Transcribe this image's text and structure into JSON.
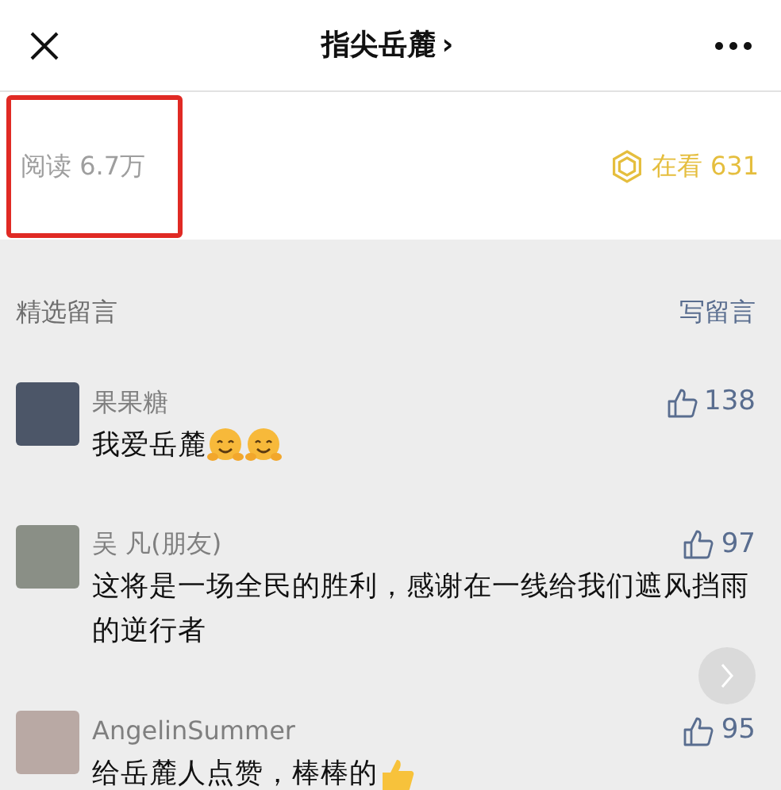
{
  "navbar": {
    "title": "指尖岳麓",
    "title_chevron": "›"
  },
  "stats": {
    "reads": "阅读 6.7万",
    "reads_highlighted": true,
    "watching": "在看 631"
  },
  "comments_header": {
    "title": "精选留言",
    "write": "写留言"
  },
  "comments": [
    {
      "name": "果果糖",
      "text": "我爱岳麓",
      "emojis": [
        {
          "kind": "hug"
        },
        {
          "kind": "hug"
        }
      ],
      "likes": "138"
    },
    {
      "name": "吴 凡(朋友)",
      "text": "这将是一场全民的胜利，感谢在一线给我们遮风挡雨的逆行者",
      "likes": "97"
    },
    {
      "name": "AngelinSummer",
      "text": "给岳麓人点赞，棒棒的",
      "emojis": [
        {
          "kind": "thumb"
        }
      ],
      "likes": "95"
    }
  ]
}
